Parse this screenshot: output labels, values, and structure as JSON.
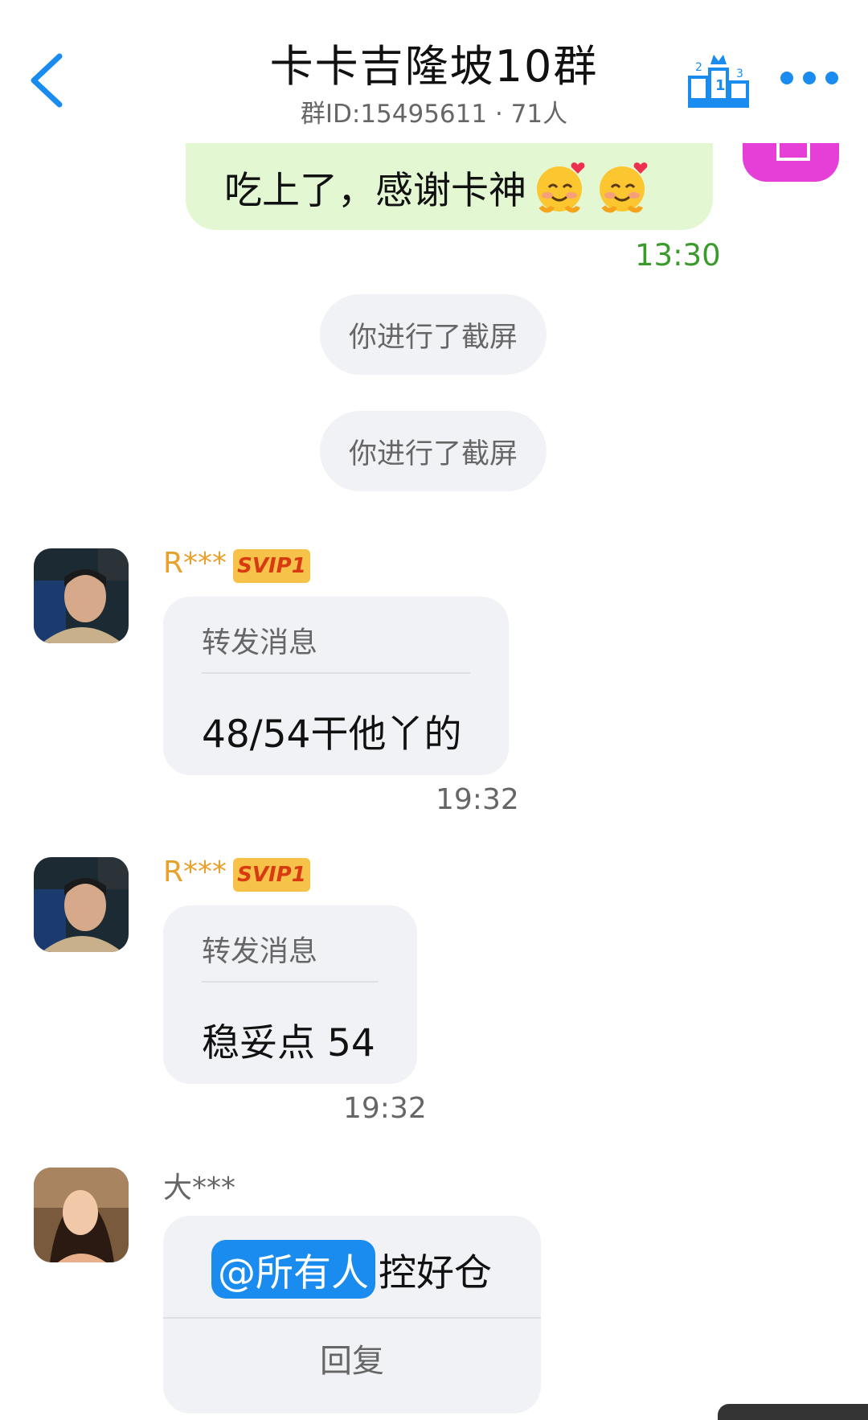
{
  "header": {
    "title": "卡卡吉隆坡10群",
    "subtitle": "群ID:15495611 · 71人"
  },
  "messages": {
    "own": {
      "text": "吃上了，感谢卡神",
      "time": "13:30"
    },
    "system": [
      "你进行了截屏",
      "你进行了截屏"
    ],
    "msg1": {
      "sender": "R***",
      "badge": "SVIP1",
      "forward_label": "转发消息",
      "text": "48/54干他丫的",
      "time": "19:32"
    },
    "msg2": {
      "sender": "R***",
      "badge": "SVIP1",
      "forward_label": "转发消息",
      "text": "稳妥点 54",
      "time": "19:32"
    },
    "msg3": {
      "sender": "大***",
      "mention": "@所有人",
      "text": "控好仓",
      "reply_label": "回复"
    }
  },
  "icons": {
    "back": "chevron-left-icon",
    "ranking": "podium-ranking-icon",
    "more": "more-dots-icon",
    "emoji": "smiling-face-with-hearts-icon"
  },
  "colors": {
    "accent": "#1a8cf0",
    "own_bubble": "#e3f7d2",
    "time_green": "#3a9a2c",
    "svip_badge": "#f7c24a",
    "name_vip": "#e8a12a"
  }
}
